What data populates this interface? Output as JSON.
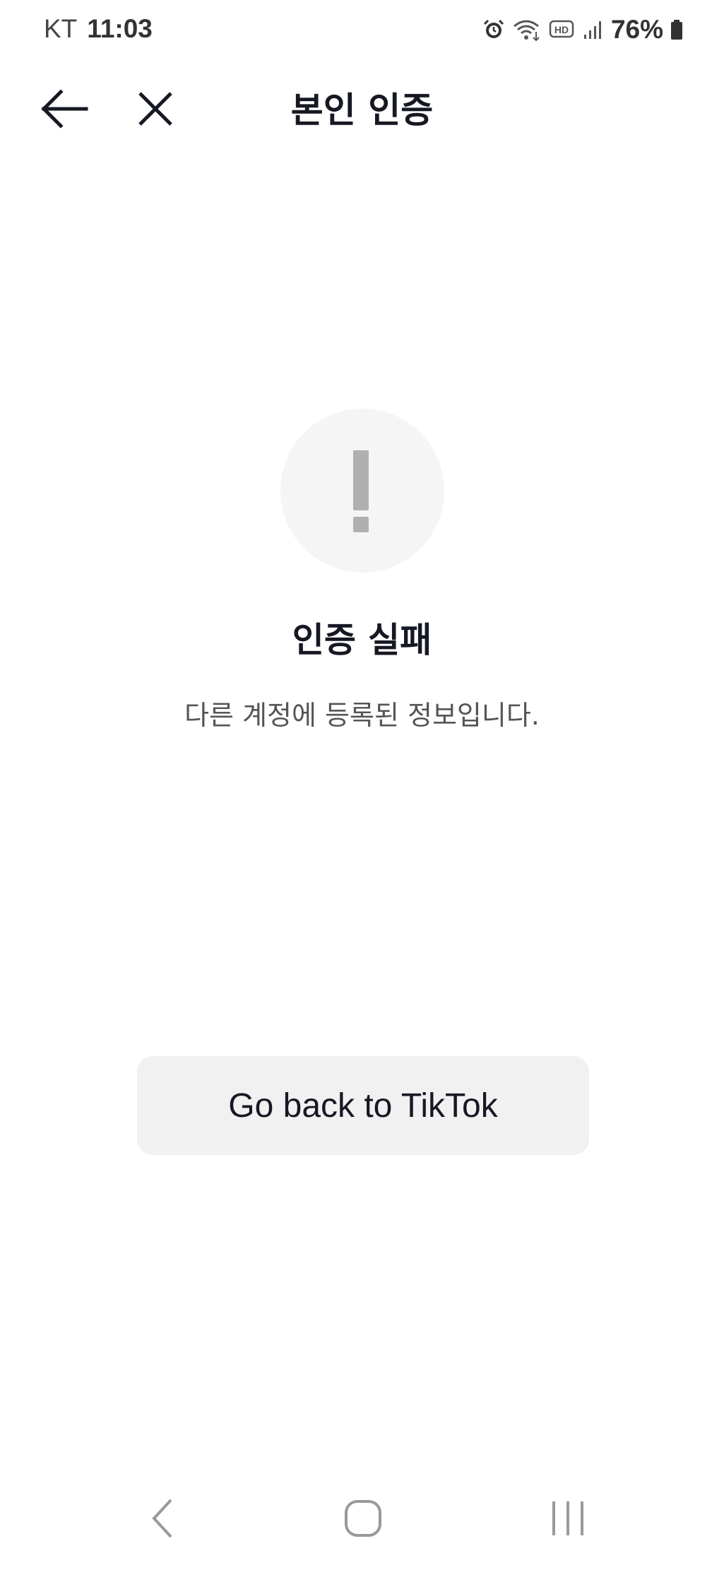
{
  "status_bar": {
    "carrier": "KT",
    "time": "11:03",
    "battery": "76%",
    "icons": [
      "alarm-icon",
      "wifi-icon",
      "hd-icon",
      "signal-icon",
      "battery-icon"
    ]
  },
  "header": {
    "title": "본인 인증",
    "back_icon": "arrow-left-icon",
    "close_icon": "close-icon"
  },
  "result": {
    "icon": "exclamation-icon",
    "title": "인증 실패",
    "description": "다른 계정에 등록된 정보입니다."
  },
  "actions": {
    "return_label": "Go back to TikTok"
  },
  "nav_bar": {
    "icons": [
      "back-nav-icon",
      "home-nav-icon",
      "recents-nav-icon"
    ]
  },
  "colors": {
    "background": "#ffffff",
    "text_primary": "#161823",
    "text_secondary": "#555555",
    "icon_circle": "#f5f5f5",
    "icon_mark": "#b0b0b0",
    "button_bg": "#f1f1f2"
  }
}
